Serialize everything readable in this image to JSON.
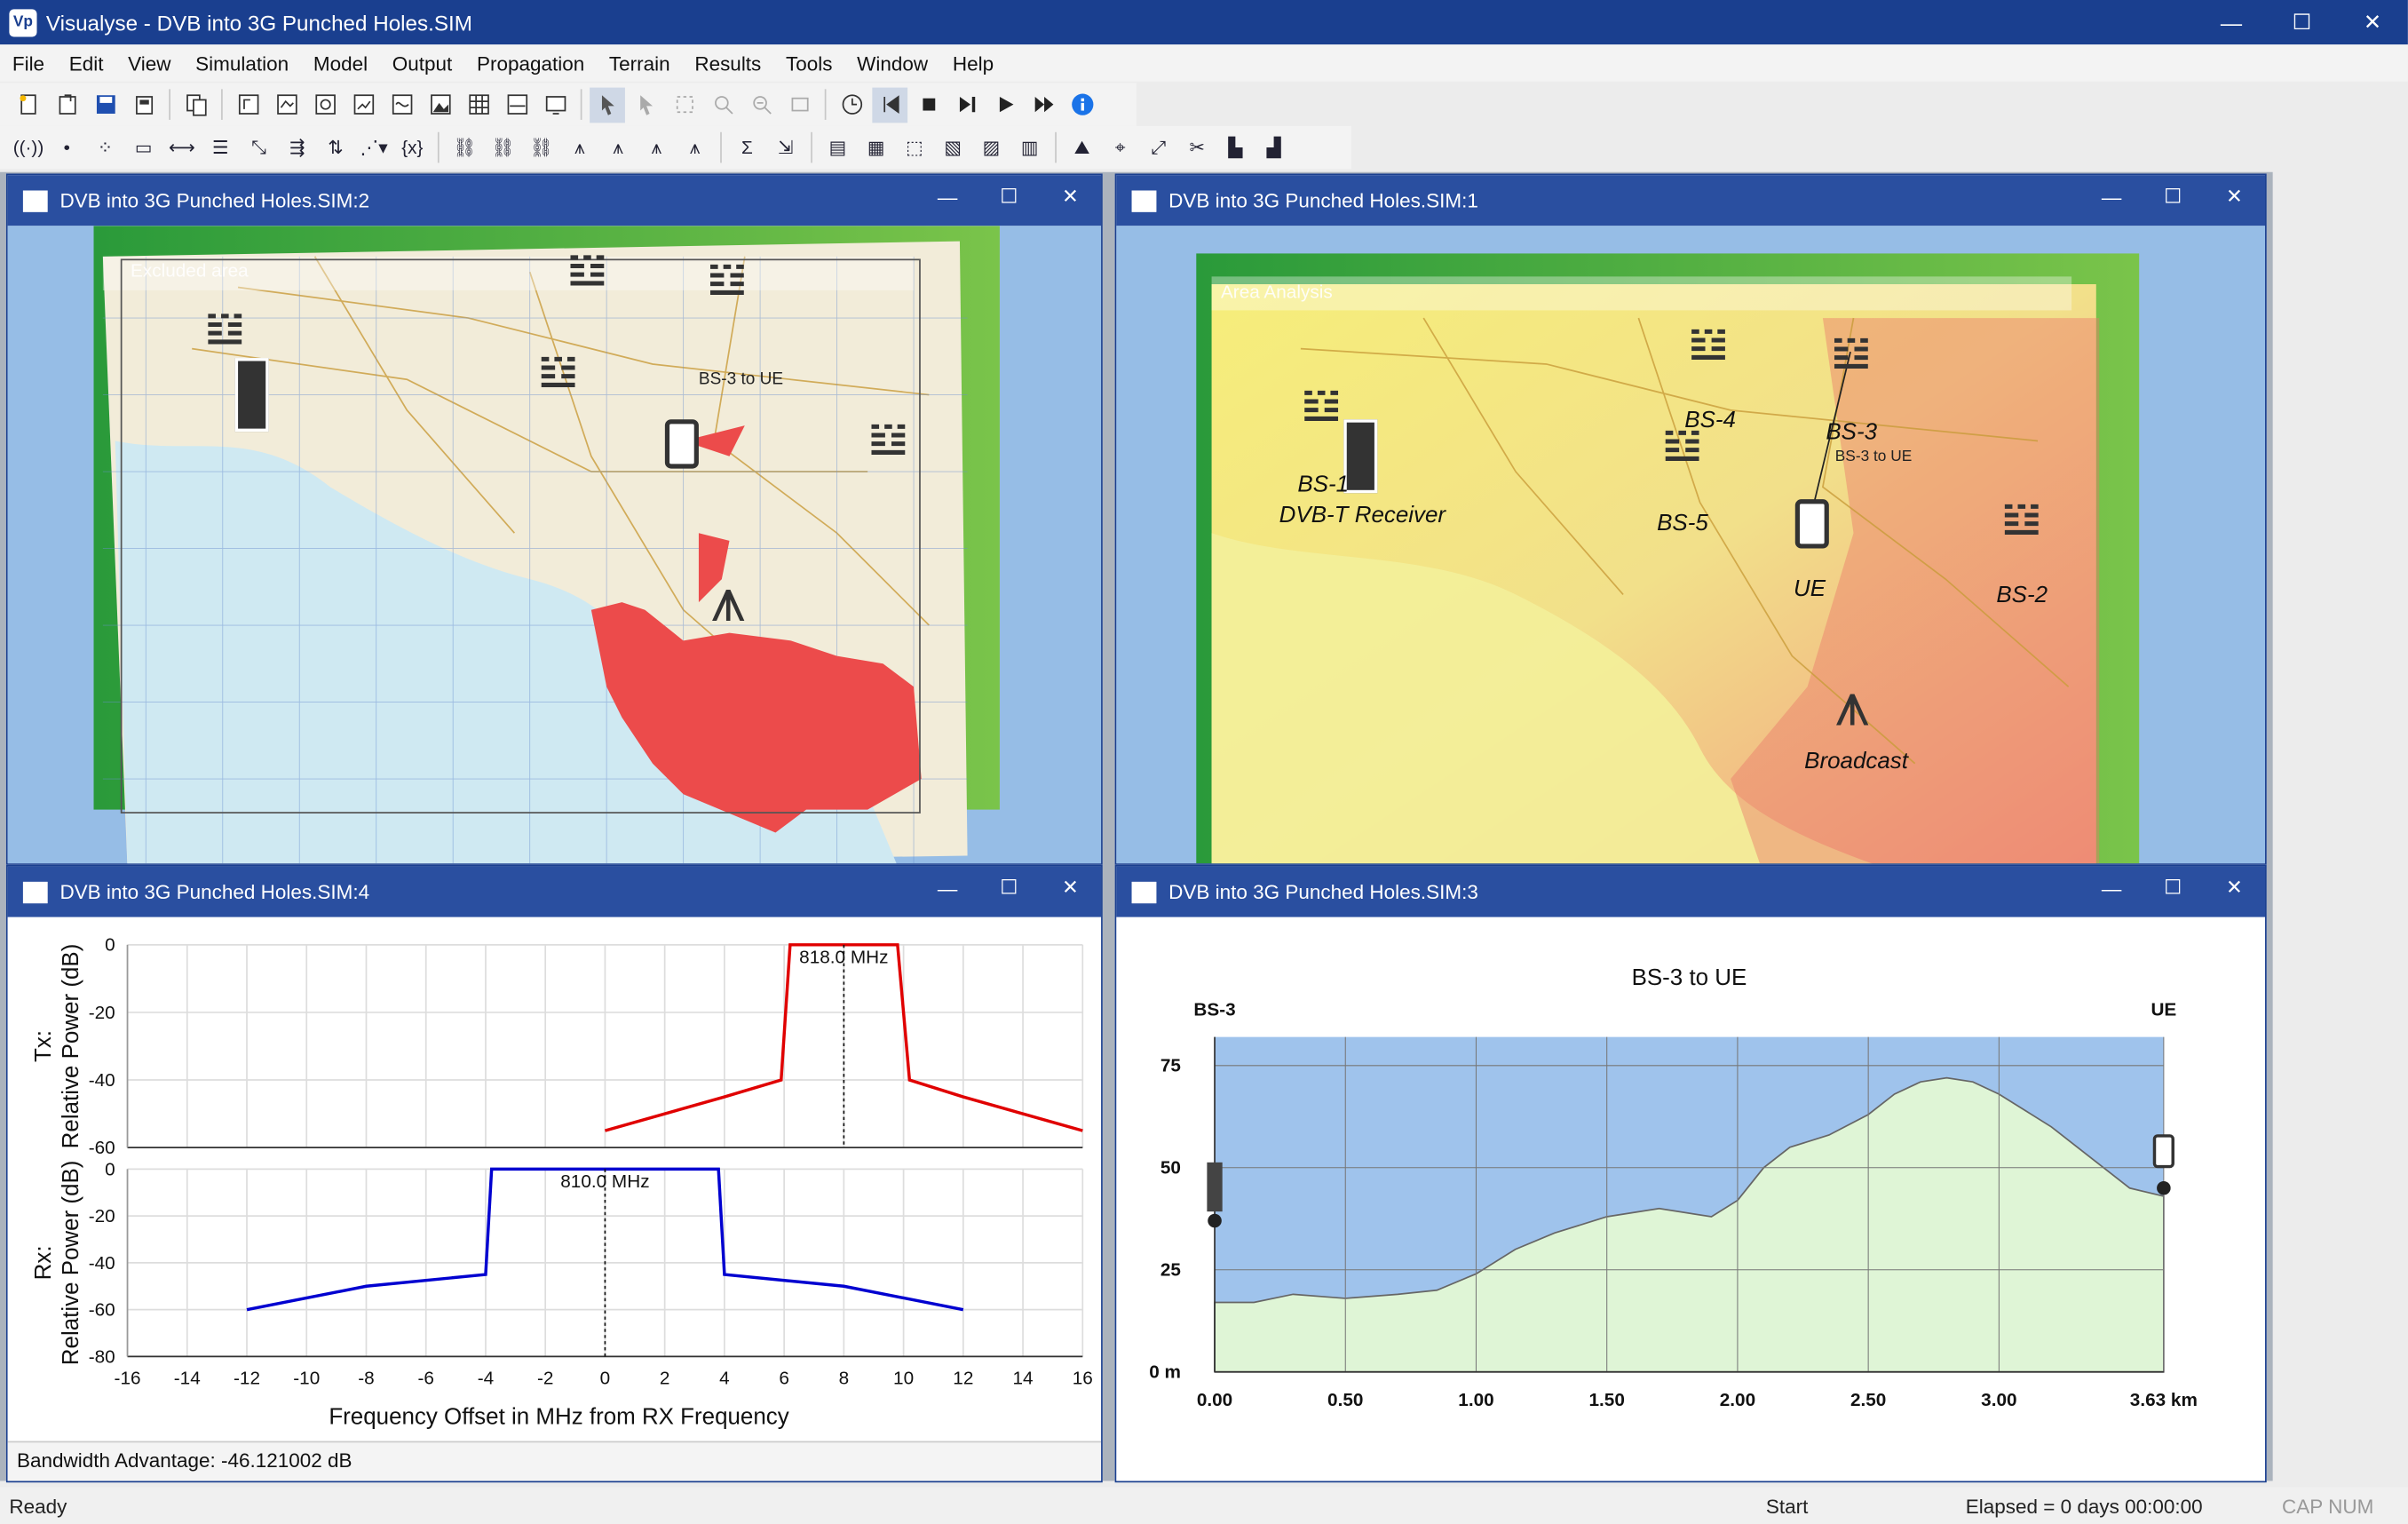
{
  "window": {
    "title": "Visualyse - DVB into 3G Punched Holes.SIM",
    "minimize": "—",
    "maximize": "☐",
    "close": "✕"
  },
  "menu": [
    "File",
    "Edit",
    "View",
    "Simulation",
    "Model",
    "Output",
    "Propagation",
    "Terrain",
    "Results",
    "Tools",
    "Window",
    "Help"
  ],
  "children": {
    "map2": {
      "title": "DVB into 3G Punched Holes.SIM:2",
      "overlay": "Excluded area",
      "link_label": "BS-3  to  UE"
    },
    "map1": {
      "title": "DVB into 3G Punched Holes.SIM:1",
      "overlay": "Area Analysis",
      "labels": {
        "bs1": "BS-1",
        "dvbt": "DVB-T Receiver",
        "bs4": "BS-4",
        "bs3": "BS-3",
        "bs5": "BS-5",
        "bs2": "BS-2",
        "ue": "UE",
        "broadcast": "Broadcast",
        "link": "BS-3  to  UE"
      }
    },
    "spectrum": {
      "title": "DVB into 3G Punched Holes.SIM:4",
      "tx_ylabel_1": "Tx:",
      "tx_ylabel_2": "Relative Power (dB)",
      "rx_ylabel_1": "Rx:",
      "rx_ylabel_2": "Relative Power (dB)",
      "xlabel": "Frequency Offset in MHz from RX Frequency",
      "tx_marker": "818.0 MHz",
      "rx_marker": "810.0 MHz",
      "bandwidth_advantage": "Bandwidth Advantage: -46.121002 dB"
    },
    "profile": {
      "title": "DVB into 3G Punched Holes.SIM:3",
      "chart_title": "BS-3  to  UE",
      "left_end": "BS-3",
      "right_end": "UE"
    }
  },
  "chart_data": [
    {
      "type": "line",
      "title": "",
      "xlabel": "Frequency Offset in MHz from RX Frequency",
      "ylabel": "Tx: Relative Power (dB)",
      "xlim": [
        -16,
        16
      ],
      "ylim": [
        -60,
        0
      ],
      "xticks": [
        "-16",
        "-14",
        "-12",
        "-10",
        "-8",
        "-6",
        "-4",
        "-2",
        "0",
        "2",
        "4",
        "6",
        "8",
        "10",
        "12",
        "14",
        "16"
      ],
      "yticks": [
        "0",
        "-20",
        "-40",
        "-60"
      ],
      "series": [
        {
          "name": "",
          "color": "#e00000",
          "x": [
            0,
            4,
            5.9,
            6.2,
            9.8,
            10.2,
            12,
            16
          ],
          "y": [
            -55,
            -45,
            -40,
            0,
            0,
            -40,
            -45,
            -55
          ]
        }
      ],
      "marker_x": 8
    },
    {
      "type": "line",
      "title": "",
      "xlabel": "Frequency Offset in MHz from RX Frequency",
      "ylabel": "Rx: Relative Power (dB)",
      "xlim": [
        -16,
        16
      ],
      "ylim": [
        -80,
        0
      ],
      "xticks": [
        "-16",
        "-14",
        "-12",
        "-10",
        "-8",
        "-6",
        "-4",
        "-2",
        "0",
        "2",
        "4",
        "6",
        "8",
        "10",
        "12",
        "14",
        "16"
      ],
      "yticks": [
        "0",
        "-20",
        "-40",
        "-60",
        "-80"
      ],
      "series": [
        {
          "name": "",
          "color": "#0000d0",
          "x": [
            -12,
            -8,
            -4,
            -3.8,
            3.8,
            4,
            8,
            12
          ],
          "y": [
            -60,
            -50,
            -45,
            0,
            0,
            -45,
            -50,
            -60
          ]
        }
      ],
      "marker_x": 0
    },
    {
      "type": "area",
      "title": "BS-3  to  UE",
      "xlabel": "",
      "ylabel": "",
      "xlim": [
        0,
        3.63
      ],
      "ylim": [
        0,
        82
      ],
      "xticks": [
        "0.00",
        "0.50",
        "1.00",
        "1.50",
        "2.00",
        "2.50",
        "3.00",
        "3.63 km"
      ],
      "yticks": [
        "0 m",
        "25",
        "50",
        "75"
      ],
      "series": [
        {
          "name": "",
          "color": "#dff5d6",
          "x": [
            0,
            0.15,
            0.3,
            0.5,
            0.7,
            0.85,
            1.0,
            1.15,
            1.3,
            1.5,
            1.7,
            1.9,
            2.0,
            2.1,
            2.2,
            2.35,
            2.5,
            2.6,
            2.7,
            2.8,
            2.9,
            3.0,
            3.1,
            3.2,
            3.3,
            3.4,
            3.5,
            3.63
          ],
          "y": [
            17,
            17,
            19,
            18,
            19,
            20,
            24,
            30,
            34,
            38,
            40,
            38,
            42,
            50,
            55,
            58,
            63,
            68,
            71,
            72,
            71,
            68,
            64,
            60,
            55,
            50,
            45,
            43
          ]
        }
      ],
      "endpoints": {
        "left_height": 37,
        "right_height": 45
      }
    }
  ],
  "status": {
    "left": "Ready",
    "mid": "Start",
    "elapsed": "Elapsed = 0 days 00:00:00",
    "caps": "CAP NUM"
  }
}
